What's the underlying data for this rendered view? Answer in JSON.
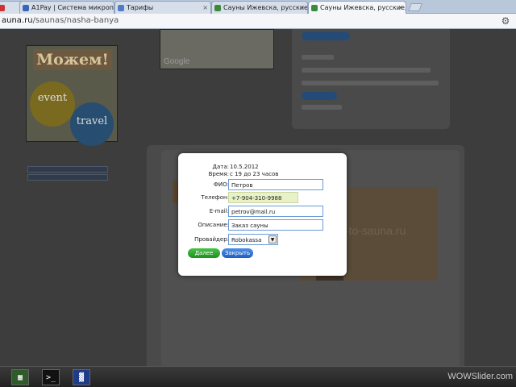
{
  "browser": {
    "tabs": [
      {
        "label": "A1Pay | Система микропла",
        "favicon_color": "#3a66b8"
      },
      {
        "label": "Тарифы",
        "favicon_color": "#4f7bc9"
      },
      {
        "label": "Сауны Ижевска, русские, ",
        "favicon_color": "#3a8a3a"
      },
      {
        "label": "Сауны Ижевска, русские, ",
        "favicon_color": "#3a8a3a",
        "active": true
      }
    ],
    "url_host": "auna.ru",
    "url_path": "/saunas/nasha-banya"
  },
  "background": {
    "banner_heading": "Можем!",
    "banner_event": "event",
    "banner_travel": "travel",
    "map_logo": "Google",
    "photo_watermark": "o-to-sauna.ru"
  },
  "modal": {
    "date_label": "Дата:",
    "date_value": "10.5.2012",
    "time_label": "Время:",
    "time_value": "с 19 до 23 часов",
    "name_label": "ФИО:",
    "name_value": "Петров",
    "phone_label": "Телефон:",
    "phone_value": "+7-904-310-9988",
    "email_label": "E-mail:",
    "email_value": "petrov@mail.ru",
    "desc_label": "Описание:",
    "desc_value": "Заказ сауны",
    "provider_label": "Провайдер:",
    "provider_value": "Robokassa",
    "submit_label": "Далее",
    "close_label": "Закрыть"
  },
  "footer": {
    "watermark": "WOWSlider.com"
  }
}
